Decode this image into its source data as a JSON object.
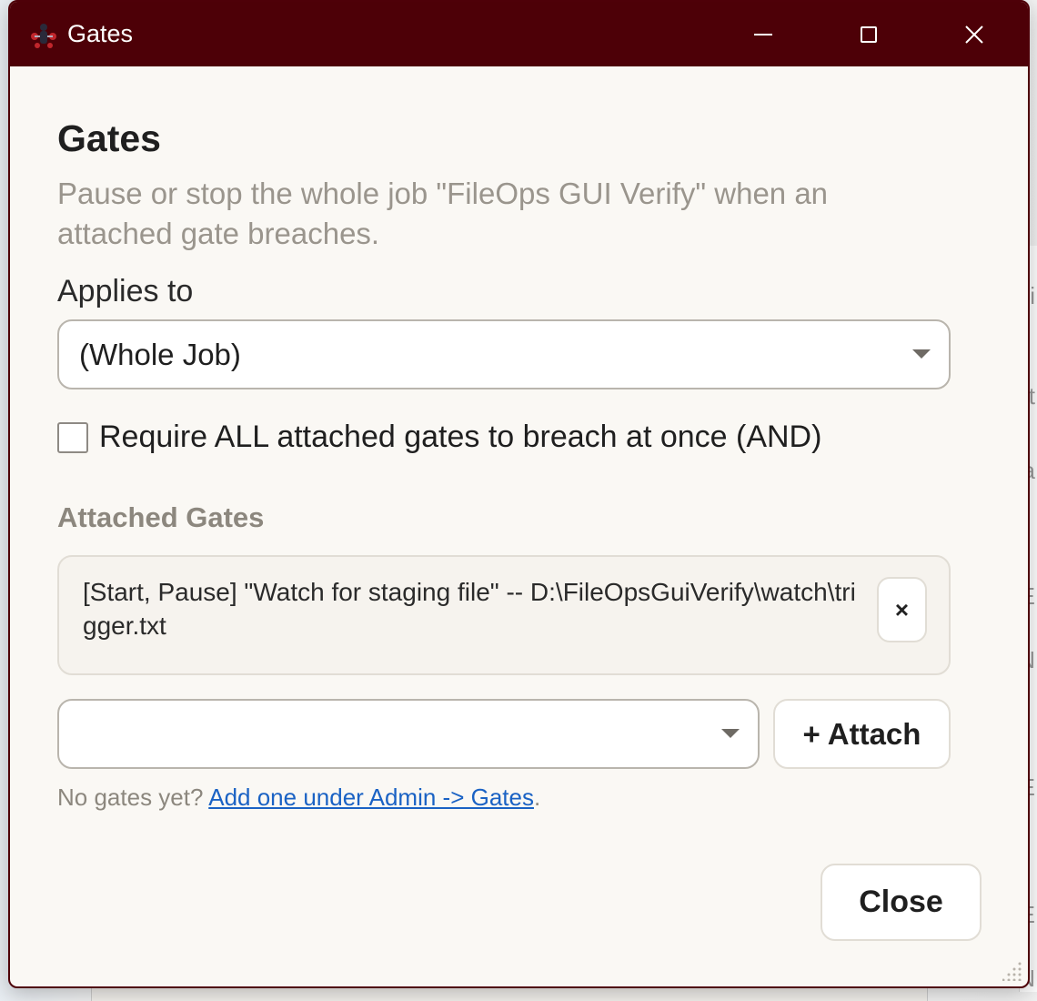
{
  "window": {
    "title": "Gates",
    "accent_color": "#4d0007"
  },
  "dialog": {
    "heading": "Gates",
    "subtitle": "Pause or stop the whole job \"FileOps GUI Verify\" when an attached gate breaches.",
    "applies_to_label": "Applies to",
    "applies_to_value": "(Whole Job)",
    "require_all_label": "Require ALL attached gates to breach at once (AND)",
    "require_all_checked": false,
    "attached_section_label": "Attached Gates",
    "attached_gates": [
      {
        "text": "[Start, Pause] \"Watch for staging file\" -- D:\\FileOpsGuiVerify\\watch\\trigger.txt",
        "remove_label": "×"
      }
    ],
    "attach_select_value": "",
    "attach_button_label": "+ Attach",
    "hint_prefix": "No gates yet? ",
    "hint_link": "Add one under Admin -> Gates",
    "hint_suffix": ".",
    "close_label": "Close"
  },
  "background": {
    "glyphs": [
      "i",
      "t",
      "a",
      "E",
      "N",
      "E",
      "E",
      "N"
    ]
  }
}
